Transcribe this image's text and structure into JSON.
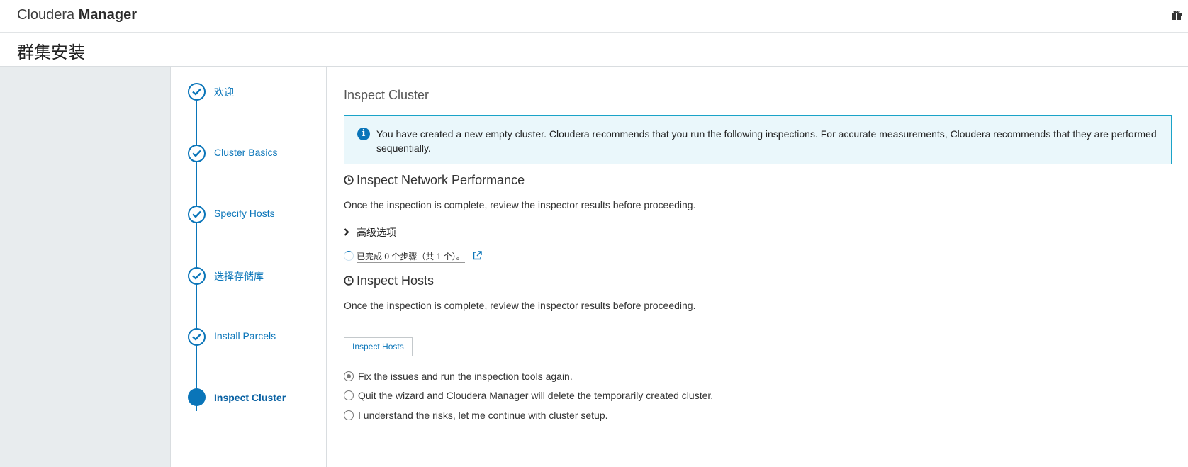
{
  "header": {
    "brand_light": "Cloudera",
    "brand_bold": "Manager",
    "gift_icon": "gift-icon"
  },
  "page": {
    "title": "群集安装"
  },
  "steps": [
    {
      "label": "欢迎",
      "state": "done"
    },
    {
      "label": "Cluster Basics",
      "state": "done"
    },
    {
      "label": "Specify Hosts",
      "state": "done"
    },
    {
      "label": "选择存储库",
      "state": "done"
    },
    {
      "label": "Install Parcels",
      "state": "done"
    },
    {
      "label": "Inspect Cluster",
      "state": "active"
    }
  ],
  "main": {
    "title": "Inspect Cluster",
    "alert": {
      "icon": "info-icon",
      "text": "You have created a new empty cluster. Cloudera recommends that you run the following inspections. For accurate measurements, Cloudera recommends that they are performed sequentially."
    },
    "network": {
      "title": "Inspect Network Performance",
      "description": "Once the inspection is complete, review the inspector results before proceeding.",
      "advanced_label": "高级选项",
      "progress_text": "已完成 0 个步骤（共 1 个）。"
    },
    "hosts": {
      "title": "Inspect Hosts",
      "description": "Once the inspection is complete, review the inspector results before proceeding.",
      "button_label": "Inspect Hosts"
    },
    "options": [
      {
        "label": "Fix the issues and run the inspection tools again.",
        "checked": true
      },
      {
        "label": "Quit the wizard and Cloudera Manager will delete the temporarily created cluster.",
        "checked": false
      },
      {
        "label": "I understand the risks, let me continue with cluster setup.",
        "checked": false
      }
    ]
  },
  "colors": {
    "accent": "#0a75b9",
    "alert_border": "#1aa3c8",
    "alert_bg": "#eaf7fb",
    "sidebar_bg": "#e8ecee"
  }
}
